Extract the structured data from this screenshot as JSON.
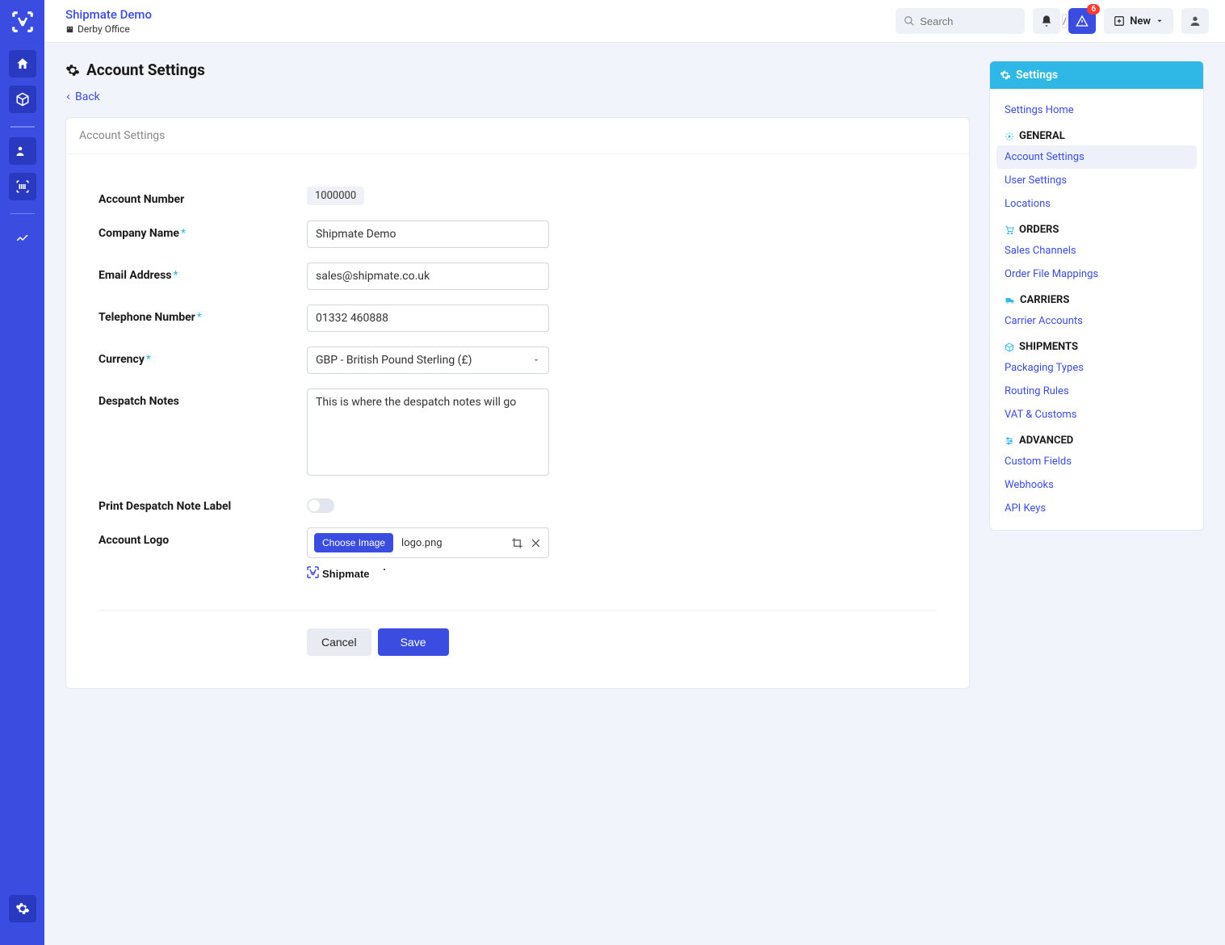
{
  "brand": {
    "title": "Shipmate Demo",
    "subtitle": "Derby Office"
  },
  "search": {
    "placeholder": "Search",
    "slash": "/"
  },
  "topbar": {
    "new_label": "New",
    "alert_count": "6"
  },
  "page": {
    "title": "Account Settings",
    "back": "Back"
  },
  "card": {
    "header": "Account Settings"
  },
  "form": {
    "account_number_label": "Account Number",
    "account_number_value": "1000000",
    "company_label": "Company Name",
    "company_value": "Shipmate Demo",
    "email_label": "Email Address",
    "email_value": "sales@shipmate.co.uk",
    "phone_label": "Telephone Number",
    "phone_value": "01332 460888",
    "currency_label": "Currency",
    "currency_value": "GBP - British Pound Sterling (£)",
    "despatch_label": "Despatch Notes",
    "despatch_value": "This is where the despatch notes will go",
    "print_label": "Print Despatch Note Label",
    "logo_label": "Account Logo",
    "choose_label": "Choose Image",
    "file_name": "logo.png",
    "cancel": "Cancel",
    "save": "Save",
    "logo_text": "Shipmate"
  },
  "panel": {
    "title": "Settings",
    "home": "Settings Home",
    "sections": {
      "general": "GENERAL",
      "orders": "ORDERS",
      "carriers": "CARRIERS",
      "shipments": "SHIPMENTS",
      "advanced": "ADVANCED"
    },
    "links": {
      "account_settings": "Account Settings",
      "user_settings": "User Settings",
      "locations": "Locations",
      "sales_channels": "Sales Channels",
      "order_file_mappings": "Order File Mappings",
      "carrier_accounts": "Carrier Accounts",
      "packaging_types": "Packaging Types",
      "routing_rules": "Routing Rules",
      "vat_customs": "VAT & Customs",
      "custom_fields": "Custom Fields",
      "webhooks": "Webhooks",
      "api_keys": "API Keys"
    }
  }
}
